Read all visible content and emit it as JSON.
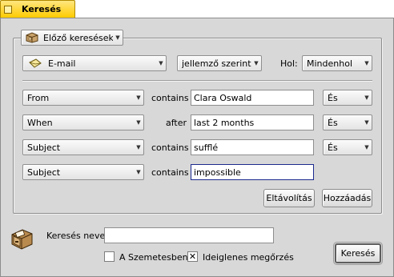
{
  "tab": {
    "title": "Keresés"
  },
  "header": {
    "recent_searches": "Előző keresések",
    "type": "E-mail",
    "mode": "jellemző szerint",
    "where_label": "Hol:",
    "where_value": "Mindenhol"
  },
  "rows": [
    {
      "attribute": "From",
      "operator": "contains",
      "value": "Clara Oswald",
      "conjunction": "És"
    },
    {
      "attribute": "When",
      "operator": "after",
      "value": "last 2 months",
      "conjunction": "És"
    },
    {
      "attribute": "Subject",
      "operator": "contains",
      "value": "sufflé",
      "conjunction": "És"
    },
    {
      "attribute": "Subject",
      "operator": "contains",
      "value": "impossible"
    }
  ],
  "buttons": {
    "remove": "Eltávolítás",
    "add": "Hozzáadás",
    "search": "Keresés"
  },
  "footer": {
    "search_name_label": "Keresés neve:",
    "search_name_value": "",
    "trash_label": "A Szemetesben is",
    "trash_checked": false,
    "temp_label": "Ideiglenes megőrzés",
    "temp_checked": true,
    "temp_check_glyph": "✕"
  },
  "icons": {
    "recent": "folder-icon",
    "type": "email-icon",
    "query": "file-cabinet-icon"
  }
}
